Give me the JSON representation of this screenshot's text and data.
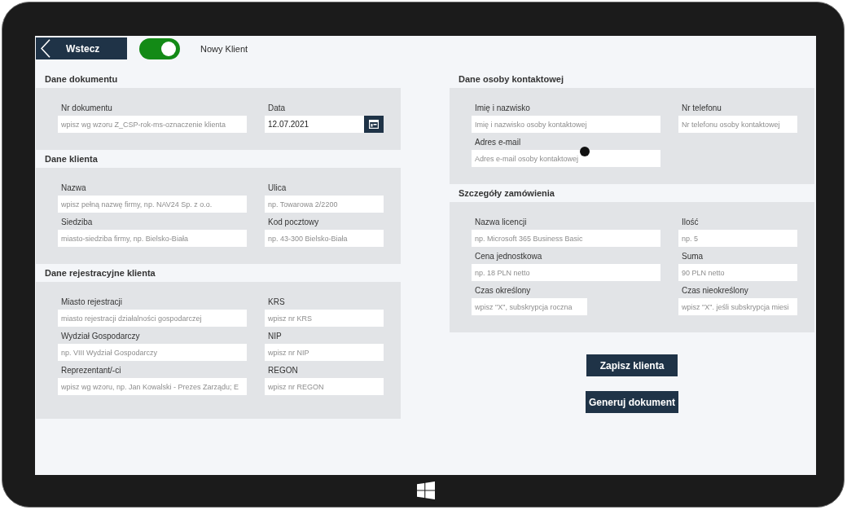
{
  "top_bar": {
    "back_button": "Wstecz",
    "toggle": {
      "on": true,
      "label": "Nowy Klient"
    }
  },
  "left_column": {
    "sections": [
      {
        "title": "Dane dokumentu",
        "rows": [
          [
            {
              "kind": "text",
              "label": "Nr dokumentu",
              "placeholder": "wpisz wg wzoru Z_CSP-rok-ms-oznaczenie klienta"
            },
            {
              "kind": "date",
              "label": "Data",
              "value": "12.07.2021"
            }
          ]
        ]
      },
      {
        "title": "Dane klienta",
        "rows": [
          [
            {
              "kind": "text",
              "label": "Nazwa",
              "placeholder": "wpisz pełną nazwę firmy, np. NAV24 Sp. z o.o."
            },
            {
              "kind": "text",
              "label": "Ulica",
              "placeholder": "np. Towarowa 2/2200"
            }
          ],
          [
            {
              "kind": "text",
              "label": "Siedziba",
              "placeholder": "miasto-siedziba firmy, np. Bielsko-Biała"
            },
            {
              "kind": "text",
              "label": "Kod pocztowy",
              "placeholder": "np. 43-300 Bielsko-Biała"
            }
          ]
        ]
      },
      {
        "title": "Dane rejestracyjne klienta",
        "rows": [
          [
            {
              "kind": "text",
              "label": "Miasto rejestracji",
              "placeholder": "miasto rejestracji działalności gospodarczej"
            },
            {
              "kind": "text",
              "label": "KRS",
              "placeholder": "wpisz nr KRS"
            }
          ],
          [
            {
              "kind": "text",
              "label": "Wydział Gospodarczy",
              "placeholder": "np. VIII Wydział Gospodarczy"
            },
            {
              "kind": "text",
              "label": "NIP",
              "placeholder": "wpisz nr NIP"
            }
          ],
          [
            {
              "kind": "text",
              "label": "Reprezentant/-ci",
              "placeholder": "wpisz wg wzoru, np. Jan Kowalski - Prezes Zarządu; E"
            },
            {
              "kind": "text",
              "label": "REGON",
              "placeholder": "wpisz nr REGON"
            }
          ]
        ]
      }
    ]
  },
  "right_column": {
    "sections": [
      {
        "title": "Dane osoby kontaktowej",
        "rows": [
          [
            {
              "kind": "text",
              "label": "Imię i nazwisko",
              "placeholder": "Imię i nazwisko osoby kontaktowej"
            },
            {
              "kind": "text",
              "label": "Nr telefonu",
              "placeholder": "Nr telefonu osoby kontaktowej"
            }
          ],
          [
            {
              "kind": "text",
              "label": "Adres e-mail",
              "placeholder": "Adres e-mail osoby kontaktowej"
            }
          ]
        ]
      },
      {
        "title": "Szczegóły zamówienia",
        "rows": [
          [
            {
              "kind": "text",
              "label": "Nazwa licencji",
              "placeholder": "np. Microsoft 365 Business Basic"
            },
            {
              "kind": "text",
              "label": "Ilość",
              "placeholder": "np. 5"
            }
          ],
          [
            {
              "kind": "text",
              "label": "Cena jednostkowa",
              "placeholder": "np. 18 PLN netto"
            },
            {
              "kind": "text",
              "label": "Suma",
              "placeholder": "90 PLN netto"
            }
          ],
          [
            {
              "kind": "text",
              "label": "Czas określony",
              "placeholder": "wpisz \"X\", subskrypcja roczna"
            },
            {
              "kind": "text",
              "label": "Czas nieokreślony",
              "placeholder": "wpisz \"X\". jeśli subskrypcja miesi"
            }
          ]
        ]
      }
    ],
    "buttons": [
      "Zapisz klienta",
      "Generuj dokument"
    ]
  }
}
